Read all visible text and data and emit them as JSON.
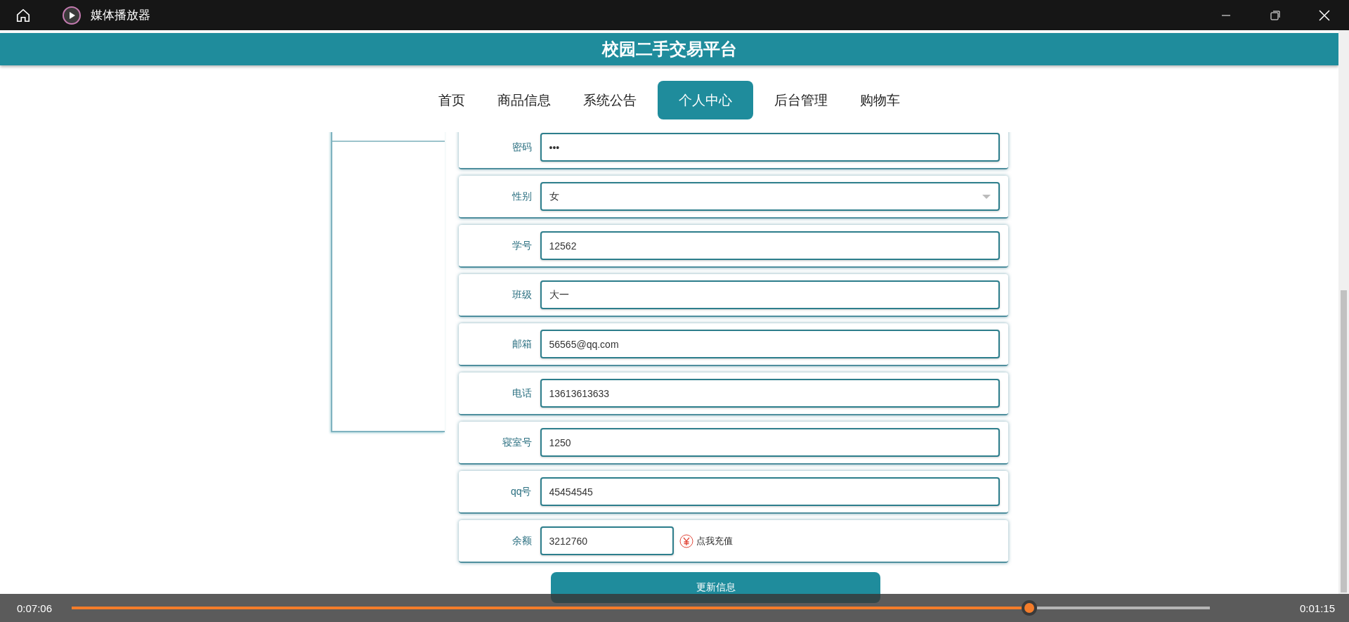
{
  "player": {
    "title": "媒体播放器",
    "elapsed": "0:07:06",
    "remaining": "0:01:15",
    "level": 0.846
  },
  "site": {
    "title": "校园二手交易平台"
  },
  "nav": [
    {
      "label": "首页",
      "selected": false
    },
    {
      "label": "商品信息",
      "selected": false
    },
    {
      "label": "系统公告",
      "selected": false
    },
    {
      "label": "个人中心",
      "selected": true
    },
    {
      "label": "后台管理",
      "selected": false
    },
    {
      "label": "购物车",
      "selected": false
    }
  ],
  "form": {
    "fields": [
      {
        "kind": "text",
        "label": "密码",
        "value": "•••"
      },
      {
        "kind": "select",
        "label": "性别",
        "value": "女"
      },
      {
        "kind": "text",
        "label": "学号",
        "value": "12562"
      },
      {
        "kind": "text",
        "label": "班级",
        "value": "大一"
      },
      {
        "kind": "text",
        "label": "邮箱",
        "value": "56565@qq.com"
      },
      {
        "kind": "text",
        "label": "电话",
        "value": "13613613633"
      },
      {
        "kind": "text",
        "label": "寝室号",
        "value": "1250"
      },
      {
        "kind": "text",
        "label": "qq号",
        "value": "45454545"
      },
      {
        "kind": "balance",
        "label": "余额",
        "value": "3212760",
        "action": "点我充值"
      }
    ],
    "submit": "更新信息"
  }
}
